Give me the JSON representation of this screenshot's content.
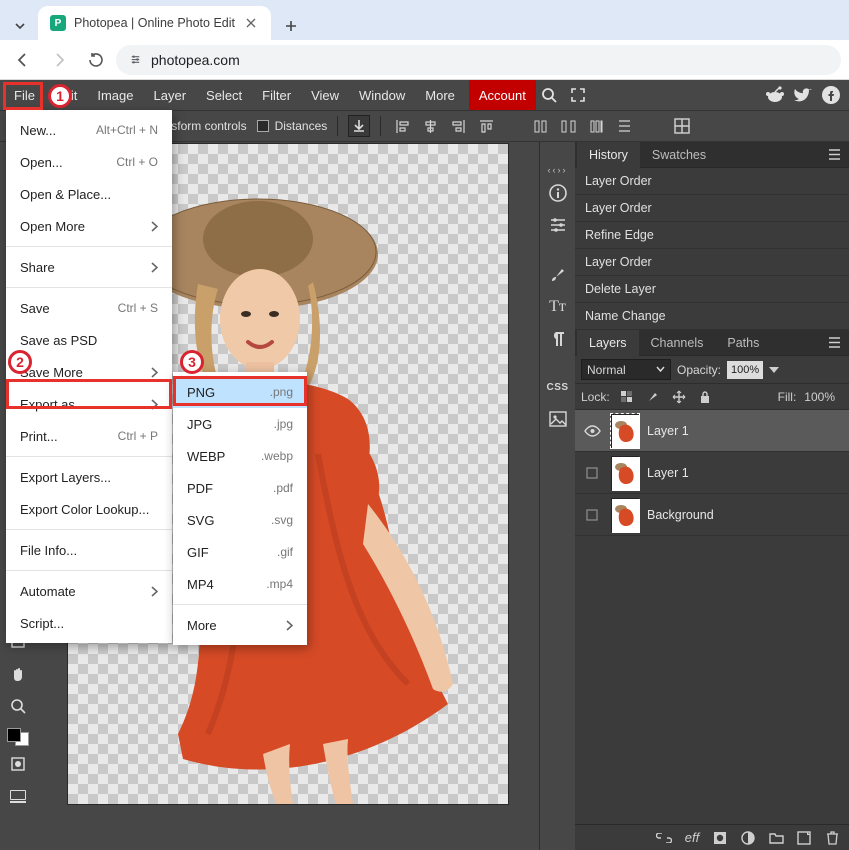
{
  "browser": {
    "tab_title": "Photopea | Online Photo Edit",
    "url": "photopea.com"
  },
  "menubar": {
    "items": [
      "File",
      "Edit",
      "Image",
      "Layer",
      "Select",
      "Filter",
      "View",
      "Window",
      "More"
    ],
    "account": "Account"
  },
  "optbar": {
    "transform_controls": "Transform controls",
    "distances": "Distances"
  },
  "file_menu": [
    {
      "label": "New...",
      "shortcut": "Alt+Ctrl + N"
    },
    {
      "label": "Open...",
      "shortcut": "Ctrl + O"
    },
    {
      "label": "Open & Place..."
    },
    {
      "label": "Open More",
      "submenu": true
    },
    {
      "sep": true
    },
    {
      "label": "Share",
      "submenu": true
    },
    {
      "sep": true
    },
    {
      "label": "Save",
      "shortcut": "Ctrl + S"
    },
    {
      "label": "Save as PSD"
    },
    {
      "label": "Save More",
      "submenu": true
    },
    {
      "label": "Export as",
      "submenu": true
    },
    {
      "label": "Print...",
      "shortcut": "Ctrl + P"
    },
    {
      "sep": true
    },
    {
      "label": "Export Layers..."
    },
    {
      "label": "Export Color Lookup..."
    },
    {
      "sep": true
    },
    {
      "label": "File Info..."
    },
    {
      "sep": true
    },
    {
      "label": "Automate",
      "submenu": true
    },
    {
      "label": "Script..."
    }
  ],
  "export_submenu": [
    {
      "label": "PNG",
      "ext": ".png",
      "sel": true
    },
    {
      "label": "JPG",
      "ext": ".jpg"
    },
    {
      "label": "WEBP",
      "ext": ".webp"
    },
    {
      "label": "PDF",
      "ext": ".pdf"
    },
    {
      "label": "SVG",
      "ext": ".svg"
    },
    {
      "label": "GIF",
      "ext": ".gif"
    },
    {
      "label": "MP4",
      "ext": ".mp4"
    },
    {
      "sep": true
    },
    {
      "label": "More",
      "submenu": true
    }
  ],
  "history": {
    "tabs": [
      "History",
      "Swatches"
    ],
    "items": [
      "Layer Order",
      "Layer Order",
      "Refine Edge",
      "Layer Order",
      "Delete Layer",
      "Name Change"
    ]
  },
  "layers_panel": {
    "tabs": [
      "Layers",
      "Channels",
      "Paths"
    ],
    "blend": "Normal",
    "opacity_label": "Opacity:",
    "opacity": "100%",
    "lock_label": "Lock:",
    "fill_label": "Fill:",
    "fill": "100%",
    "layers": [
      {
        "name": "Layer 1",
        "visible": true,
        "sel": true
      },
      {
        "name": "Layer 1",
        "visible": false,
        "sel": false
      },
      {
        "name": "Background",
        "visible": false,
        "sel": false
      }
    ]
  },
  "footer_eff": "eff",
  "annotations": {
    "a1": "1",
    "a2": "2",
    "a3": "3"
  }
}
